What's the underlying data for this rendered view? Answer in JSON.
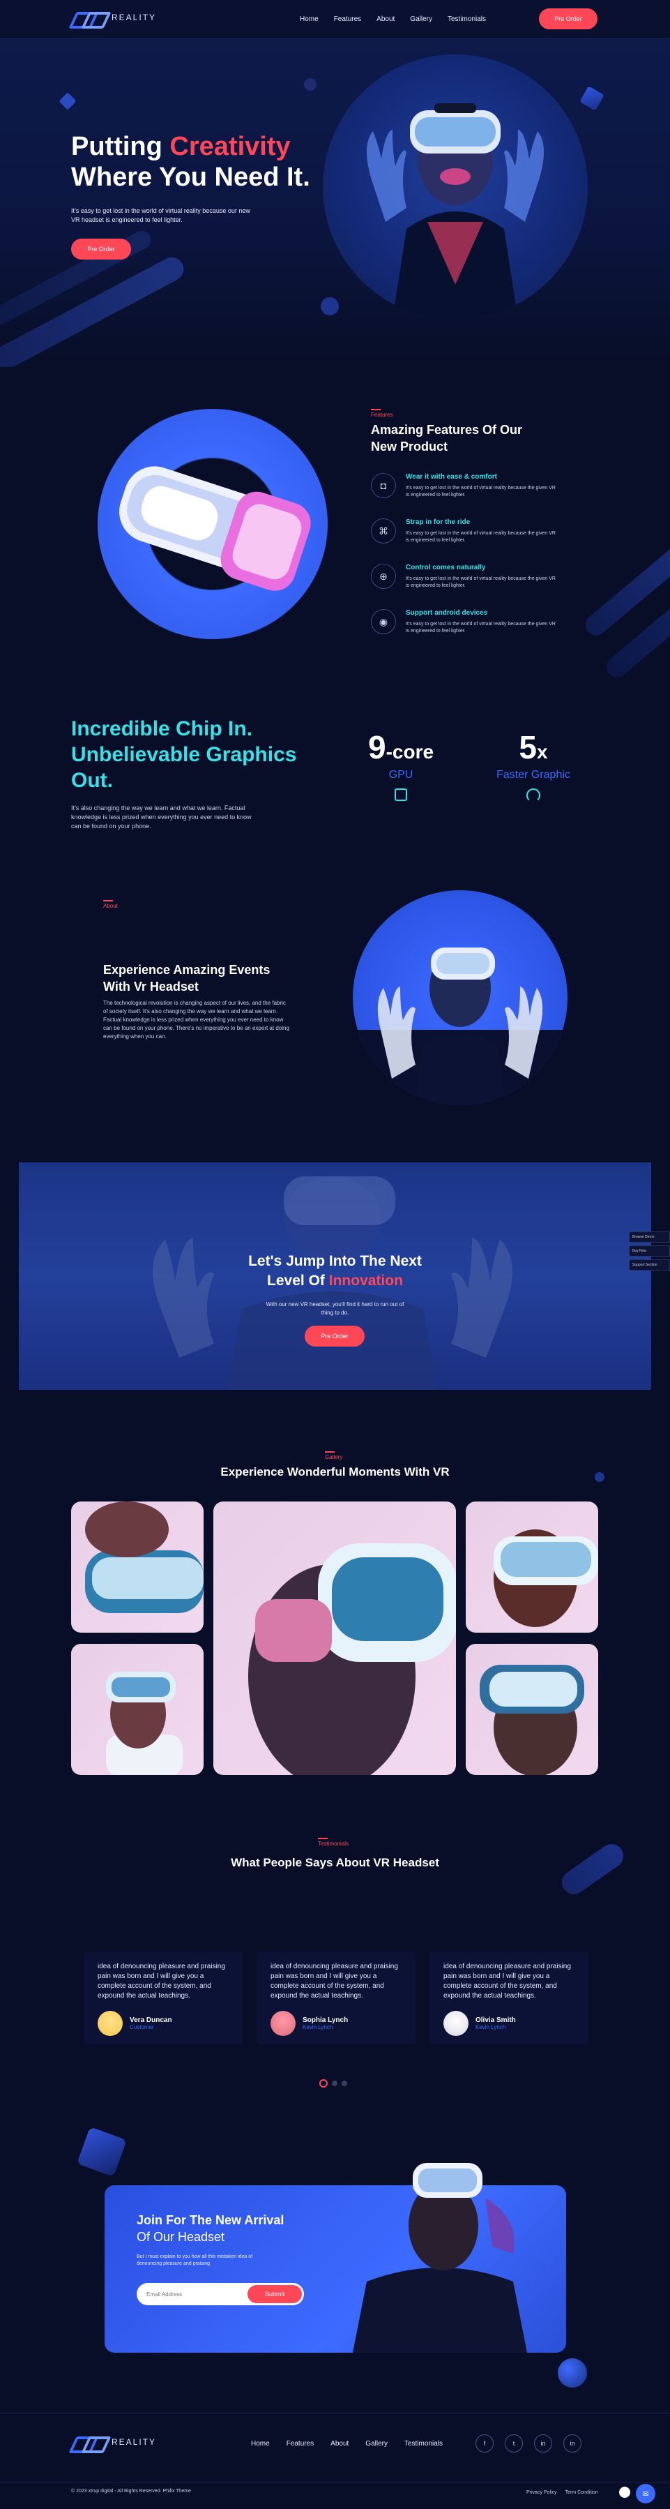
{
  "nav": {
    "brand": "REALITY",
    "links": [
      "Home",
      "Features",
      "About",
      "Gallery",
      "Testimonials"
    ],
    "cta": "Pre Order"
  },
  "hero": {
    "title_part1": "Putting",
    "title_highlight": "Creativity",
    "title_line2": "Where You Need It.",
    "description": "It's easy to get lost in the world of virtual reality because our new VR headset is engineered to feel lighter.",
    "cta": "Pre Order"
  },
  "features": {
    "label": "Features",
    "title_line1": "Amazing Features Of Our",
    "title_line2": "New Product",
    "items": [
      {
        "icon": "vr-headset-icon",
        "title": "Wear it with ease & comfort",
        "desc": "It's easy to get lost in the world of virtual reality because the given VR is engineered to feel lighter."
      },
      {
        "icon": "gamepad-icon",
        "title": "Strap in for the ride",
        "desc": "It's easy to get lost in the world of virtual reality because the given VR is engineered to feel lighter."
      },
      {
        "icon": "controller-icon",
        "title": "Control comes naturally",
        "desc": "It's easy to get lost in the world of virtual reality because the given VR is engineered to feel lighter."
      },
      {
        "icon": "android-icon",
        "title": "Support android devices",
        "desc": "It's easy to get lost in the world of virtual reality because the given VR is engineered to feel lighter."
      }
    ]
  },
  "chip": {
    "title_line1": "Incredible Chip In.",
    "title_line2": "Unbelievable Graphics",
    "title_line3": "Out.",
    "description": "It's also changing the way we learn and what we learn. Factual knowledge is less prized when everything you ever need to know can be found on your phone.",
    "stats": [
      {
        "value": "9",
        "suffix": "-core",
        "label": "GPU",
        "icon": "cpu-icon"
      },
      {
        "value": "5",
        "suffix": "x",
        "label": "Faster Graphic",
        "icon": "speedometer-icon"
      }
    ]
  },
  "events": {
    "label": "About",
    "title_line1": "Experience Amazing Events",
    "title_line2": "With Vr Headset",
    "description": "The technological revolution is changing aspect of our lives, and the fabric of society itself. It's also changing the way we learn and what we learn. Factual knowledge is less prized when everything you ever need to know can be found on your phone. There's no imperative to be an expert at doing everything when you can."
  },
  "cta_banner": {
    "title_line1": "Let's Jump Into The Next",
    "title_line2_prefix": "Level Of",
    "title_highlight": "Innovation",
    "description": "With our new VR headset, you'll find it hard to run out of thing to do.",
    "cta": "Pre Order"
  },
  "side_widget": [
    "Browse Demo",
    "Buy Now",
    "Support Section"
  ],
  "gallery": {
    "label": "Gallery",
    "title": "Experience Wonderful Moments With VR"
  },
  "testimonials": {
    "label": "Testimonials",
    "title": "What People Says About VR Headset",
    "items": [
      {
        "text": "idea of denouncing pleasure and praising pain was born and I will give you a complete account of the system, and expound the actual teachings.",
        "name": "Vera Duncan",
        "role": "Customer",
        "avatar_color": "#f5c94d"
      },
      {
        "text": "idea of denouncing pleasure and praising pain was born and I will give you a complete account of the system, and expound the actual teachings.",
        "name": "Sophia Lynch",
        "role": "Kevin Lynch",
        "avatar_color": "#e06a7a"
      },
      {
        "text": "idea of denouncing pleasure and praising pain was born and I will give you a complete account of the system, and expound the actual teachings.",
        "name": "Olivia Smith",
        "role": "Kevin Lynch",
        "avatar_color": "#e8e8ee"
      }
    ]
  },
  "newsletter": {
    "title_line1": "Join For The New Arrival",
    "title_line2": "Of Our Headset",
    "description": "But I must explain to you how all this mistaken idea of denouncing pleasure and praising",
    "placeholder": "Email Address",
    "cta": "Submit"
  },
  "footer": {
    "brand": "REALITY",
    "links": [
      "Home",
      "Features",
      "About",
      "Gallery",
      "Testimonials"
    ],
    "socials": [
      "f",
      "t",
      "in",
      "in"
    ],
    "copyright": "© 2023 xtrup digital - All Rights Reserved. Philix Theme",
    "legal": [
      "Privacy Policy",
      "Term Condition"
    ]
  },
  "colors": {
    "accent": "#ff4757",
    "cyan": "#38e0e8",
    "blue": "#3d6bff",
    "bg": "#080e27"
  }
}
